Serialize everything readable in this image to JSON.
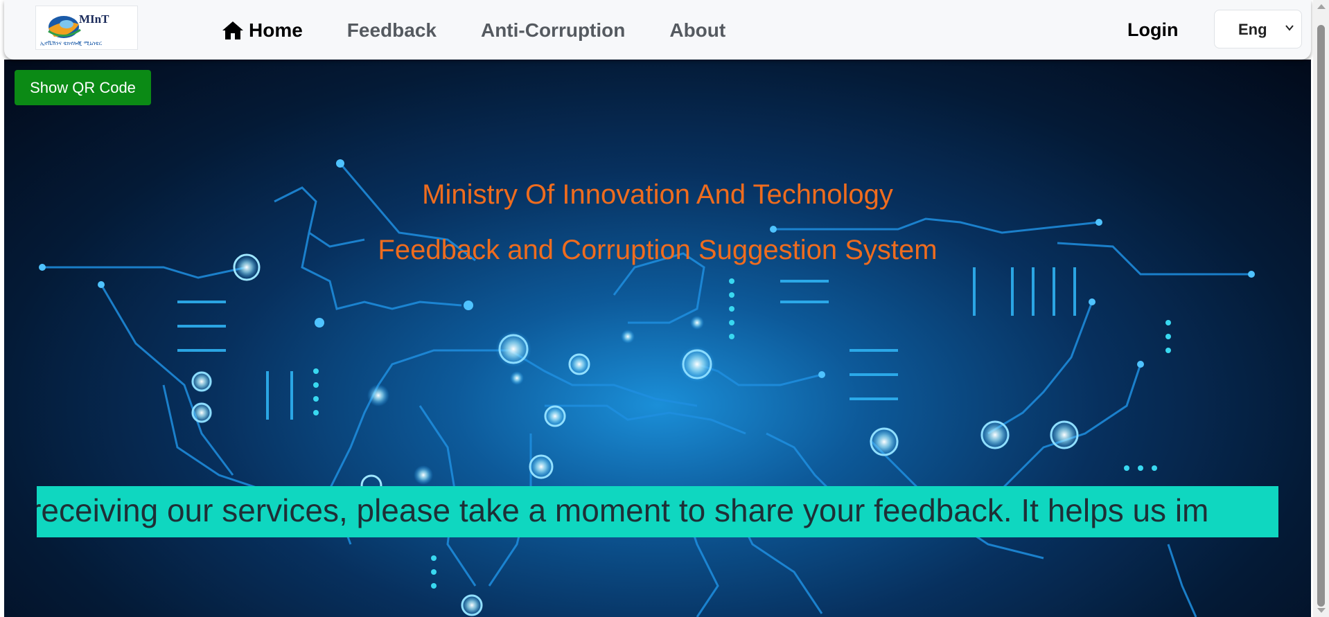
{
  "logo": {
    "text": "MInT",
    "subtext": "ኢኖቬሽንና ቴክኖሎጂ ሚኒስቴር"
  },
  "nav": {
    "home": "Home",
    "feedback": "Feedback",
    "anti_corruption": "Anti-Corruption",
    "about": "About",
    "active": "Home",
    "icons": {
      "home": "home-icon"
    }
  },
  "header": {
    "login": "Login",
    "language": "Eng",
    "language_icon": "chevron-down-icon"
  },
  "qr_button": {
    "label": "Show QR Code",
    "color": "#0b8a15"
  },
  "hero": {
    "title": "Ministry Of Innovation And Technology",
    "subtitle": "Feedback and Corruption Suggestion System",
    "title_color": "#ef6c1e"
  },
  "ticker": {
    "text": "r receiving our services, please take a moment to share your feedback. It helps us im",
    "background": "#0fd7c0"
  }
}
